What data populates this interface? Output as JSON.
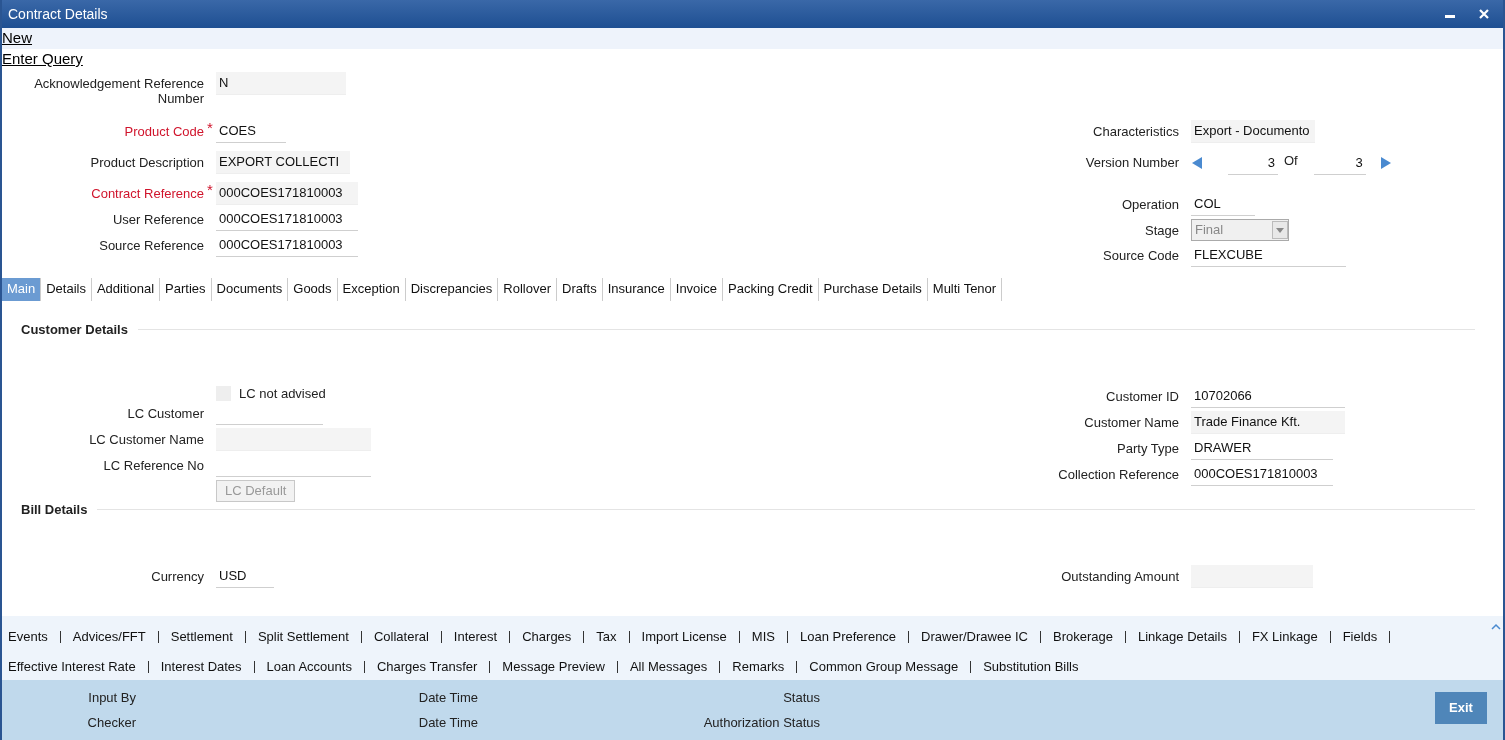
{
  "window": {
    "title": "Contract Details"
  },
  "actions": [
    "New",
    "Enter Query"
  ],
  "required_mark": "*",
  "header_left": [
    {
      "label": "Acknowledgement Reference Number",
      "required": false,
      "kind": "readonly",
      "value": "N"
    },
    {
      "label": "Product Code",
      "required": true,
      "kind": "text",
      "value": "COES"
    },
    {
      "label": "Product Description",
      "required": false,
      "kind": "readonly",
      "value": "EXPORT COLLECTI"
    },
    {
      "label": "Contract Reference",
      "required": true,
      "kind": "readonly",
      "value": "000COES171810003"
    },
    {
      "label": "User Reference",
      "required": false,
      "kind": "text",
      "value": "000COES171810003"
    },
    {
      "label": "Source Reference",
      "required": false,
      "kind": "text",
      "value": "000COES171810003"
    }
  ],
  "header_right": [
    {
      "label": "Characteristics",
      "kind": "readonly",
      "value": "Export  - Documento"
    },
    {
      "label": "Version Number",
      "kind": "version",
      "value": "3",
      "of_label": "Of",
      "total": "3"
    },
    {
      "label": "Operation",
      "kind": "text",
      "value": "COL"
    },
    {
      "label": "Stage",
      "kind": "select",
      "value": "Final",
      "disabled": true
    },
    {
      "label": "Source Code",
      "kind": "text",
      "value": "FLEXCUBE"
    }
  ],
  "tabs": [
    {
      "label": "Main",
      "selected": true
    },
    {
      "label": "Details",
      "selected": false
    },
    {
      "label": "Additional",
      "selected": false
    },
    {
      "label": "Parties",
      "selected": false
    },
    {
      "label": "Documents",
      "selected": false
    },
    {
      "label": "Goods",
      "selected": false
    },
    {
      "label": "Exception",
      "selected": false
    },
    {
      "label": "Discrepancies",
      "selected": false
    },
    {
      "label": "Rollover",
      "selected": false
    },
    {
      "label": "Drafts",
      "selected": false
    },
    {
      "label": "Insurance",
      "selected": false
    },
    {
      "label": "Invoice",
      "selected": false
    },
    {
      "label": "Packing Credit",
      "selected": false
    },
    {
      "label": "Purchase Details",
      "selected": false
    },
    {
      "label": "Multi Tenor",
      "selected": false
    }
  ],
  "customer_details": {
    "title": "Customer Details",
    "left": [
      {
        "kind": "checkbox",
        "label": "LC not advised",
        "checked": false,
        "disabled": true
      },
      {
        "kind": "text",
        "label": "LC Customer"
      },
      {
        "kind": "readonly",
        "label": "LC Customer Name"
      },
      {
        "kind": "text",
        "label": "LC Reference No"
      },
      {
        "kind": "button",
        "label": "LC Default",
        "disabled": true
      }
    ],
    "right": [
      {
        "kind": "text",
        "label": "Customer ID",
        "value": "10702066"
      },
      {
        "kind": "readonly",
        "label": "Customer Name",
        "value": "Trade Finance Kft."
      },
      {
        "kind": "text",
        "label": "Party Type",
        "value": "DRAWER"
      },
      {
        "kind": "text",
        "label": "Collection Reference",
        "value": "000COES171810003"
      }
    ]
  },
  "bill_details": {
    "title": "Bill Details",
    "left": [
      {
        "kind": "text",
        "label": "Currency",
        "value": "USD"
      }
    ],
    "right": [
      {
        "kind": "readonly",
        "label": "Outstanding Amount"
      }
    ]
  },
  "footer_links": [
    [
      "Events",
      "Advices/FFT",
      "Settlement",
      "Split Settlement",
      "Collateral",
      "Interest",
      "Charges",
      "Tax",
      "Import License",
      "MIS",
      "Loan Preference",
      "Drawer/Drawee IC",
      "Brokerage",
      "Linkage Details",
      "FX Linkage",
      "Fields"
    ],
    [
      "Effective Interest Rate",
      "Interest Dates",
      "Loan Accounts",
      "Charges Transfer",
      "Message Preview",
      "All Messages",
      "Remarks",
      "Common Group Message",
      "Substitution Bills"
    ]
  ],
  "audit": [
    [
      "Input By",
      "Date Time",
      "Status"
    ],
    [
      "Checker",
      "Date Time",
      "Authorization Status"
    ]
  ],
  "exit_button": "Exit"
}
